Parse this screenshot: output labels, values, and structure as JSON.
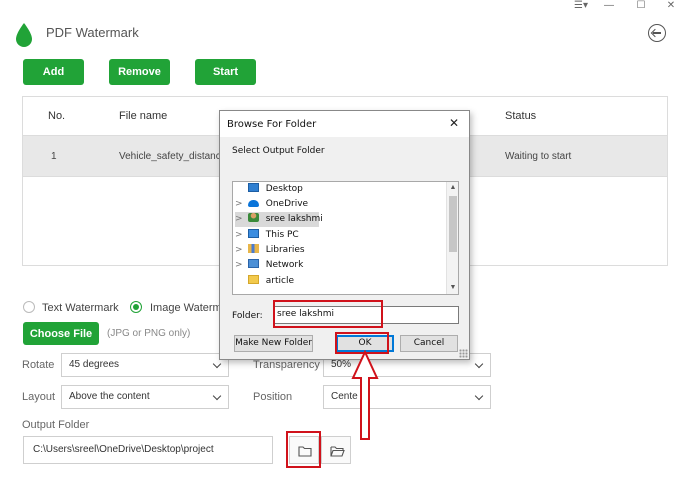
{
  "window_controls": {
    "menu": "☰▾",
    "minimize": "—",
    "maximize": "☐",
    "close": "✕"
  },
  "app": {
    "title": "PDF Watermark"
  },
  "toolbar": {
    "add": "Add",
    "remove": "Remove",
    "start": "Start"
  },
  "table": {
    "headers": {
      "no": "No.",
      "file_name": "File name",
      "status": "Status"
    },
    "rows": [
      {
        "no": "1",
        "file_name": "Vehicle_safety_distanc",
        "status": "Waiting to start"
      }
    ]
  },
  "options": {
    "text_watermark": "Text Watermark",
    "image_watermark": "Image Waterma",
    "choose_file": "Choose File",
    "choose_hint": "(JPG or PNG only)",
    "rotate_label": "Rotate",
    "rotate_value": "45 degrees",
    "transparency_label": "Transparency",
    "transparency_value": "50%",
    "layout_label": "Layout",
    "layout_value": "Above the content",
    "position_label": "Position",
    "position_value": "Cente",
    "output_label": "Output Folder",
    "output_path": "C:\\Users\\sreel\\OneDrive\\Desktop\\project"
  },
  "dialog": {
    "title": "Browse For Folder",
    "subtitle": "Select Output Folder",
    "tree": [
      {
        "label": "Desktop",
        "icon": "desktop-icon",
        "expander": ""
      },
      {
        "label": "OneDrive",
        "icon": "cloud-icon",
        "expander": ">"
      },
      {
        "label": "sree lakshmi",
        "icon": "user-icon",
        "expander": ">"
      },
      {
        "label": "This PC",
        "icon": "computer-icon",
        "expander": ">"
      },
      {
        "label": "Libraries",
        "icon": "libraries-icon",
        "expander": ">"
      },
      {
        "label": "Network",
        "icon": "network-icon",
        "expander": ">"
      },
      {
        "label": "article",
        "icon": "folder-icon",
        "expander": ""
      }
    ],
    "folder_label": "Folder:",
    "folder_value": "sree lakshmi",
    "make_new_folder": "Make New Folder",
    "ok": "OK",
    "cancel": "Cancel"
  },
  "colors": {
    "accent": "#21a337",
    "annotation": "#d0121b",
    "dialog_default_border": "#0078d7"
  }
}
